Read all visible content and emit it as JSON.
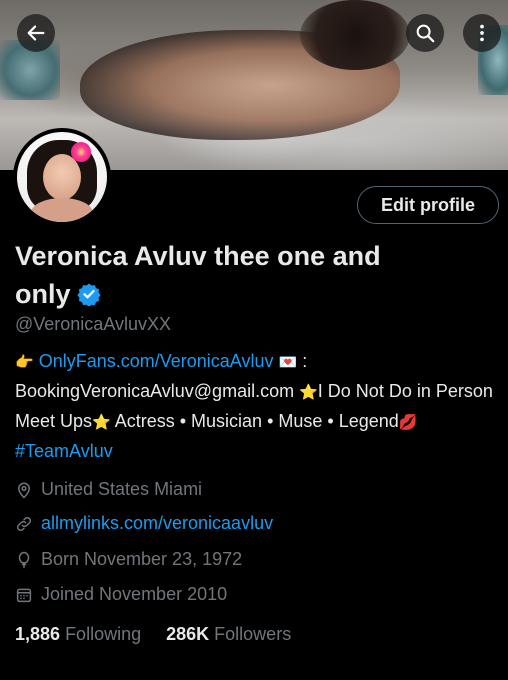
{
  "header": {
    "back_icon": "arrow-left-icon",
    "search_icon": "search-icon",
    "more_icon": "more-vertical-icon"
  },
  "profile": {
    "name": "Veronica Avluv thee one and only",
    "handle": "@VeronicaAvluvXX",
    "edit_label": "Edit profile",
    "verified": true,
    "bio": {
      "point_emoji": "👉",
      "onlyfans_link": "OnlyFans.com/VeronicaAvluv",
      "love_letter_emoji": "💌",
      "colon": ":",
      "email_text": "BookingVeronicaAvluv@gmail.com",
      "star_emoji": "⭐",
      "text_after_star": "I Do Not Do in Person Meet Ups",
      "star_emoji_2": "⭐",
      "roles_text": " Actress • Musician • Muse • Legend",
      "lips_emoji": "💋",
      "hashtag": "#TeamAvluv"
    },
    "location": "United States Miami",
    "website": "allmylinks.com/veronicaavluv",
    "born": "Born November 23, 1972",
    "joined": "Joined November 2010",
    "following_count": "1,886",
    "following_label": "Following",
    "followers_count": "286K",
    "followers_label": "Followers"
  },
  "colors": {
    "background": "#000000",
    "text_primary": "#e7e9ea",
    "text_secondary": "#71767b",
    "link": "#1d9bf0",
    "verified": "#1d9bf0",
    "button_border": "#536471"
  }
}
